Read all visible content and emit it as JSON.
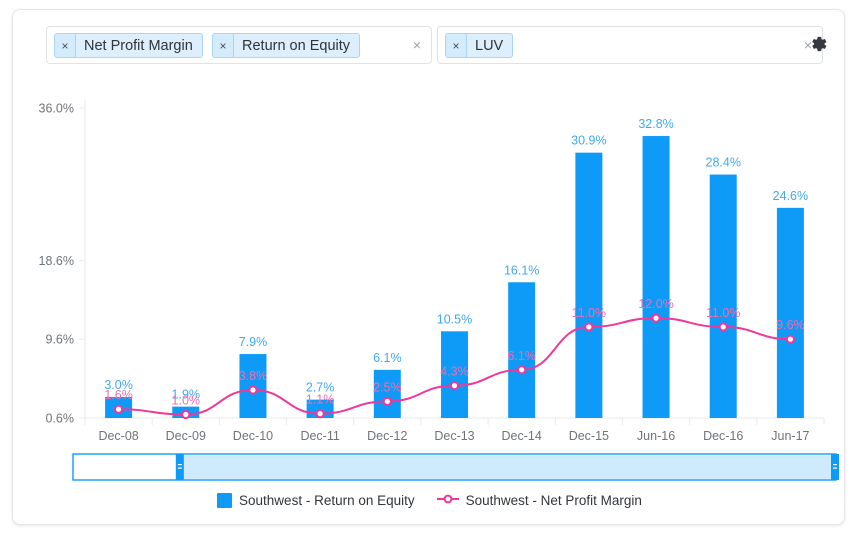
{
  "selector": {
    "metrics_box": {
      "chips": [
        {
          "label": "Net Profit Margin",
          "remove": "×"
        },
        {
          "label": "Return on Equity",
          "remove": "×"
        }
      ],
      "clear_all": "×"
    },
    "ticker_box": {
      "chips": [
        {
          "label": "LUV",
          "remove": "×"
        }
      ],
      "clear_all": "×"
    },
    "settings_icon": "gear-icon"
  },
  "colors": {
    "bar": "#0d9bf7",
    "line": "#f0379a",
    "bar_label": "#3fa9f5",
    "line_label": "#f56bb0",
    "axis_text": "#6e7479",
    "grid": "#e8eaec",
    "scrollbar_selected": "#cfe9fd",
    "scrollbar_handle": "#0d9bf7"
  },
  "legend": [
    {
      "name": "Southwest - Return on Equity",
      "type": "bar",
      "color": "#0d9bf7"
    },
    {
      "name": "Southwest - Net Profit Margin",
      "type": "line",
      "color": "#f0379a"
    }
  ],
  "scrollbar": {
    "left_handle_label": "≡",
    "right_handle_label": "≡",
    "selected_from_pct": 14,
    "selected_to_pct": 100
  },
  "chart_data": {
    "type": "bar",
    "title": "",
    "xlabel": "",
    "ylabel": "",
    "categories": [
      "Dec-08",
      "Dec-09",
      "Dec-10",
      "Dec-11",
      "Dec-12",
      "Dec-13",
      "Dec-14",
      "Dec-15",
      "Jun-16",
      "Dec-16",
      "Jun-17"
    ],
    "ytick_labels": [
      "36.0%",
      "18.6%",
      "9.6%",
      "0.6%"
    ],
    "ytick_values": [
      36.0,
      18.6,
      9.6,
      0.6
    ],
    "ylim": [
      0.6,
      36.0
    ],
    "grid": false,
    "legend_position": "bottom",
    "series": [
      {
        "name": "Southwest - Return on Equity",
        "type": "bar",
        "color": "#0d9bf7",
        "values": [
          3.0,
          1.9,
          7.9,
          2.7,
          6.1,
          10.5,
          16.1,
          30.9,
          32.8,
          28.4,
          24.6
        ],
        "labels": [
          "3.0%",
          "1.9%",
          "7.9%",
          "2.7%",
          "6.1%",
          "10.5%",
          "16.1%",
          "30.9%",
          "32.8%",
          "28.4%",
          "24.6%"
        ]
      },
      {
        "name": "Southwest - Net Profit Margin",
        "type": "line",
        "color": "#f0379a",
        "values": [
          1.6,
          1.0,
          3.8,
          1.1,
          2.5,
          4.3,
          6.1,
          11.0,
          12.0,
          11.0,
          9.6
        ],
        "labels": [
          "1.6%",
          "1.0%",
          "3.8%",
          "1.1%",
          "2.5%",
          "4.3%",
          "6.1%",
          "11.0%",
          "12.0%",
          "11.0%",
          "9.6%"
        ]
      }
    ]
  }
}
